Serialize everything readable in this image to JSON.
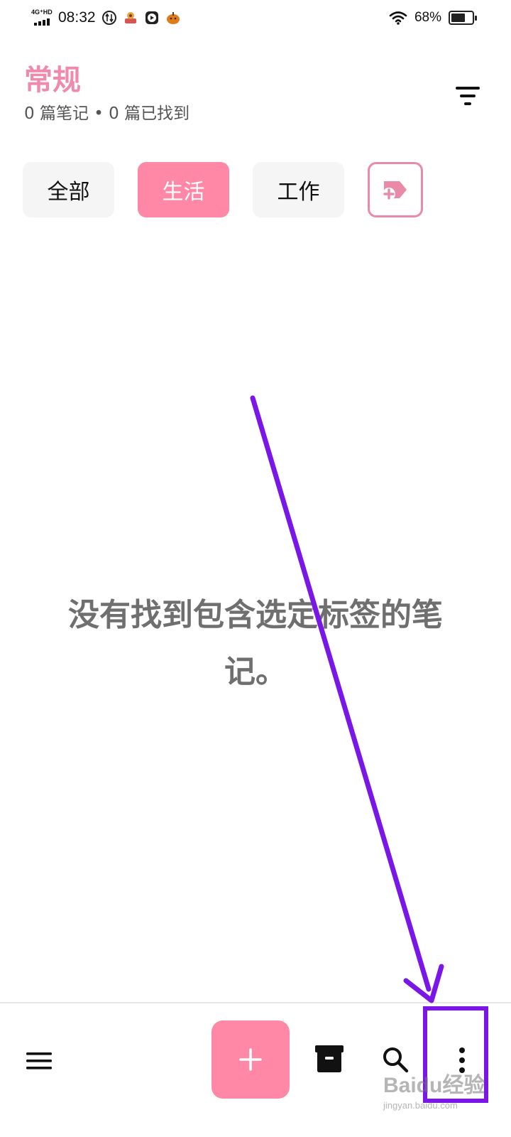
{
  "status_bar": {
    "network": "4G⁺HD",
    "time": "08:32",
    "battery_percent": "68%",
    "battery_level": 0.68,
    "icons": [
      "signal-icon",
      "data-saver-icon",
      "app-notification-icon",
      "media-player-icon",
      "pumpkin-app-icon",
      "wifi-icon",
      "battery-icon"
    ]
  },
  "header": {
    "title": "常规",
    "subtitle": "0 篇笔记 • 0 篇已找到",
    "filter_icon": "filter-icon"
  },
  "tags": {
    "items": [
      {
        "label": "全部",
        "selected": false
      },
      {
        "label": "生活",
        "selected": true
      },
      {
        "label": "工作",
        "selected": false
      }
    ],
    "add_icon": "add-tag-icon"
  },
  "empty_state": {
    "line1": "没有找到包含选定标签的笔",
    "line2": "记。"
  },
  "bottom_bar": {
    "icons": [
      "menu-icon",
      "plus-icon",
      "archive-icon",
      "search-icon",
      "more-vertical-icon"
    ]
  },
  "annotation": {
    "color": "#7a16e6"
  },
  "colors": {
    "accent": "#fe88a6",
    "title": "#f08aac",
    "tag_bg": "#f5f5f5",
    "empty_text": "#6f6f6f"
  },
  "watermark": {
    "brand": "Baidu",
    "suffix": "经验",
    "sub": "jingyan.baidu.com"
  }
}
